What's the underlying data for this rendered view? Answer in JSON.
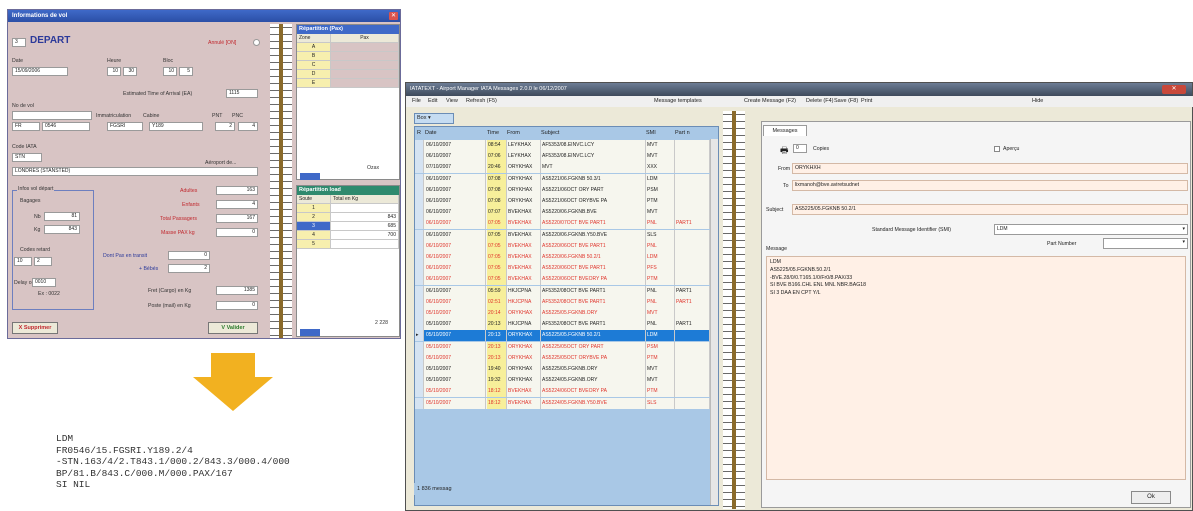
{
  "dialog": {
    "title": "Informations de vol",
    "direction_prefix": "3",
    "direction": "DEPART",
    "cancel_label": "Annulé [ON]",
    "date_label": "Date",
    "date_value": "15/09/2006",
    "heure_label": "Heure",
    "heure_h": "10",
    "heure_m": "30",
    "bloc_label": "Bloc",
    "bloc_h": "10",
    "bloc_m": "5",
    "eta_label": "Estimated Time of Arrival (EA)",
    "eta_value": "1115",
    "novol_label": "No de vol",
    "immat_label": "Immatriculation",
    "cabine_label": "Cabine",
    "pnt_label": "PNT",
    "pnc_label": "PNC",
    "airline_value": "FR",
    "flightno_value": "0546",
    "immat_value": "FGSRI",
    "cabine_value": "Y189",
    "pnt_value": "2",
    "pnc_value": "4",
    "iata_label": "Code IATA",
    "iata_value": "STN",
    "airport_label": "Aéroport de...",
    "airport_value": "LONDRES (STANSTED)",
    "infos_label": "Infos vol départ",
    "bagages_label": "Bagages",
    "nb_label": "Nb",
    "nb_value": "81",
    "kg_label": "Kg",
    "kg_value": "843",
    "codes_retard_label": "Codes retard",
    "retard_1": "10",
    "retard_2": "2",
    "delay_label": "Delay on",
    "delay_value": "0010",
    "ex_label": "Ex : 0022",
    "adultes_label": "Adultes",
    "adultes_value": "163",
    "enfants_label": "Enfants",
    "enfants_value": "4",
    "total_pax_label": "Total Passagers",
    "total_pax_value": "167",
    "masse_label": "Masse PAX kg",
    "masse_value": "0",
    "transit_label": "Dont Pax en transit",
    "transit_value": "0",
    "bebes_label": "+ Bébés",
    "bebes_value": "2",
    "fret_label": "Fret (Cargo) en Kg",
    "fret_value": "1385",
    "poste_label": "Poste (mail) en Kg",
    "poste_value": "0",
    "delete_label": "X Supprimer",
    "validate_label": "V Valider",
    "rep_pax_title": "Répartition (Pax)",
    "rep_pax_head": [
      "Zone",
      "Pax"
    ],
    "rep_pax_zones": [
      "A",
      "B",
      "C",
      "D",
      "E"
    ],
    "rep_pax_total_label": "Ozax",
    "rep_load_title": "Répartition load",
    "rep_load_head": [
      "Soute",
      "Total en Kg"
    ],
    "rep_load_rows": [
      [
        "1",
        ""
      ],
      [
        "2",
        "843"
      ],
      [
        "3",
        "685"
      ],
      [
        "4",
        "700"
      ],
      [
        "5",
        ""
      ]
    ],
    "rep_load_total": "2 228"
  },
  "ldm_text": "LDM\nFR0546/15.FGSRI.Y189.2/4\n-STN.163/4/2.T843.1/000.2/843.3/000.4/000\nBP/81.B/843.C/000.M/000.PAX/167\nSI NIL",
  "window": {
    "title": "IATATEXT - Airport Manager IATA Messages 2.0.0 le 06/12/2007",
    "menu_left": [
      "File",
      "Edit",
      "View",
      "Refresh (F5)"
    ],
    "menu_templates": "Message templates",
    "menu_right": [
      "Create Message (F2)",
      "Delete (F4)",
      "Save (F8)",
      "Print"
    ],
    "menu_hide": "Hide",
    "box_label": "Box",
    "grid_headers": [
      "R",
      "Date",
      "Time",
      "From",
      "Subject",
      "SMI",
      "Part n"
    ],
    "rows": [
      {
        "d": "06/10/2007",
        "t": "08:54",
        "f": "LEYKHAX",
        "s": "AF5353/08.EINVC.LCY",
        "m": "MVT",
        "p": "",
        "c": "n"
      },
      {
        "d": "06/10/2007",
        "t": "07:06",
        "f": "LEYKHAX",
        "s": "AF5353/08.EINVC.LCY",
        "m": "MVT",
        "p": "",
        "c": "n"
      },
      {
        "d": "07/10/2007",
        "t": "20:46",
        "f": "ORYKHAX",
        "s": "MVT",
        "m": "XXX",
        "p": "",
        "c": "n"
      },
      {
        "d": "06/10/2007",
        "t": "07:08",
        "f": "ORYKHAX",
        "s": "AS5221/06.FGKNB 50.3/1",
        "m": "LDM",
        "p": "",
        "c": "n"
      },
      {
        "d": "06/10/2007",
        "t": "07:08",
        "f": "ORYKHAX",
        "s": "AS5221/06OCT ORY PART",
        "m": "PSM",
        "p": "",
        "c": "n"
      },
      {
        "d": "06/10/2007",
        "t": "07:08",
        "f": "ORYKHAX",
        "s": "AS5221/06OCT ORYBVE PA",
        "m": "PTM",
        "p": "",
        "c": "n"
      },
      {
        "d": "06/10/2007",
        "t": "07:07",
        "f": "BVEKHAX",
        "s": "AS5220/06.FGKNB.BVE",
        "m": "MVT",
        "p": "",
        "c": "n"
      },
      {
        "d": "06/10/2007",
        "t": "07:05",
        "f": "BVEKHAX",
        "s": "AS5220/07OCT BVE PART1",
        "m": "PNL",
        "p": "PART1",
        "c": "r"
      },
      {
        "d": "06/10/2007",
        "t": "07:05",
        "f": "BVEKHAX",
        "s": "AS5220/06.FGKNB.Y50.BVE",
        "m": "SLS",
        "p": "",
        "c": "n"
      },
      {
        "d": "06/10/2007",
        "t": "07:05",
        "f": "BVEKHAX",
        "s": "AS5220/06OCT BVE PART1",
        "m": "PNL",
        "p": "",
        "c": "r"
      },
      {
        "d": "06/10/2007",
        "t": "07:05",
        "f": "BVEKHAX",
        "s": "AS5220/06.FGKNB 50.2/1",
        "m": "LDM",
        "p": "",
        "c": "r"
      },
      {
        "d": "06/10/2007",
        "t": "07:05",
        "f": "BVEKHAX",
        "s": "AS5220/06OCT BVE PART1",
        "m": "PFS",
        "p": "",
        "c": "r"
      },
      {
        "d": "06/10/2007",
        "t": "07:05",
        "f": "BVEKHAX",
        "s": "AS5220/06OCT BVEORY PA",
        "m": "PTM",
        "p": "",
        "c": "r"
      },
      {
        "d": "06/10/2007",
        "t": "05:59",
        "f": "HKJCPNA",
        "s": "AF5352/08OCT BVE PART1",
        "m": "PNL",
        "p": "PART1",
        "c": "n"
      },
      {
        "d": "06/10/2007",
        "t": "02:51",
        "f": "HKJCPNA",
        "s": "AF5352/08OCT BVE PART1",
        "m": "PNL",
        "p": "PART1",
        "c": "r"
      },
      {
        "d": "05/10/2007",
        "t": "20:14",
        "f": "ORYKHAX",
        "s": "AS5225/05.FGKNB.ORY",
        "m": "MVT",
        "p": "",
        "c": "r"
      },
      {
        "d": "05/10/2007",
        "t": "20:13",
        "f": "HKJCPNA",
        "s": "AF5352/08OCT BVE PART1",
        "m": "PNL",
        "p": "PART1",
        "c": "n"
      },
      {
        "d": "05/10/2007",
        "t": "20:13",
        "f": "ORYKHAX",
        "s": "AS5225/05.FGKNB 50.2/1",
        "m": "LDM",
        "p": "",
        "c": "s"
      },
      {
        "d": "05/10/2007",
        "t": "20:13",
        "f": "ORYKHAX",
        "s": "AS5225/05OCT ORY PART",
        "m": "PSM",
        "p": "",
        "c": "r"
      },
      {
        "d": "05/10/2007",
        "t": "20:13",
        "f": "ORYKHAX",
        "s": "AS5225/05OCT ORYBVE PA",
        "m": "PTM",
        "p": "",
        "c": "r"
      },
      {
        "d": "05/10/2007",
        "t": "19:40",
        "f": "ORYKHAX",
        "s": "AS5225/05.FGKNB.ORY",
        "m": "MVT",
        "p": "",
        "c": "n"
      },
      {
        "d": "05/10/2007",
        "t": "19:32",
        "f": "ORYKHAX",
        "s": "AS5224/05.FGKNB.ORY",
        "m": "MVT",
        "p": "",
        "c": "n"
      },
      {
        "d": "05/10/2007",
        "t": "18:12",
        "f": "BVEKHAX",
        "s": "AS5224/06OCT BVEORY PA",
        "m": "PTM",
        "p": "",
        "c": "r"
      },
      {
        "d": "05/10/2007",
        "t": "18:12",
        "f": "BVEKHAX",
        "s": "AS5224/05.FGKNB.Y50.BVE",
        "m": "SLS",
        "p": "",
        "c": "r"
      }
    ],
    "footer": "1 836 messag",
    "tab_label": "Messages",
    "copies_value": "0",
    "copies_label": "Copies",
    "apercu_label": "Aperçu",
    "from_label": "From",
    "from_value": "ORYKHXH",
    "to_label": "To",
    "to_value": "lixmanoh@bve.aviretsudnet",
    "subject_label": "Subject",
    "subject_value": "AS5225/05.FGKNB 50.2/1",
    "smi_label": "Standard Message Identifier (SMI)",
    "smi_value": "LDM",
    "message_label": "Message",
    "part_label": "Part Number",
    "message_body": "LDM\nAS5225/05.FGKNB.50.2/1\n-BVE.28/0/0.T165.1/0/Fr0/8.PAX/33\nSI BVE B166.CHL ENL MNL NBR.BAG18\nSI 3 DAA EN CPT Y/L",
    "ok_label": "Ok"
  },
  "colors": {
    "dialog_bg": "#d8c4c4",
    "title_blue": "#3f69c8",
    "label_red": "#c0272d",
    "row_red": "#e0342b",
    "row_selected": "#1d7bd6",
    "arrow": "#f2b120"
  }
}
